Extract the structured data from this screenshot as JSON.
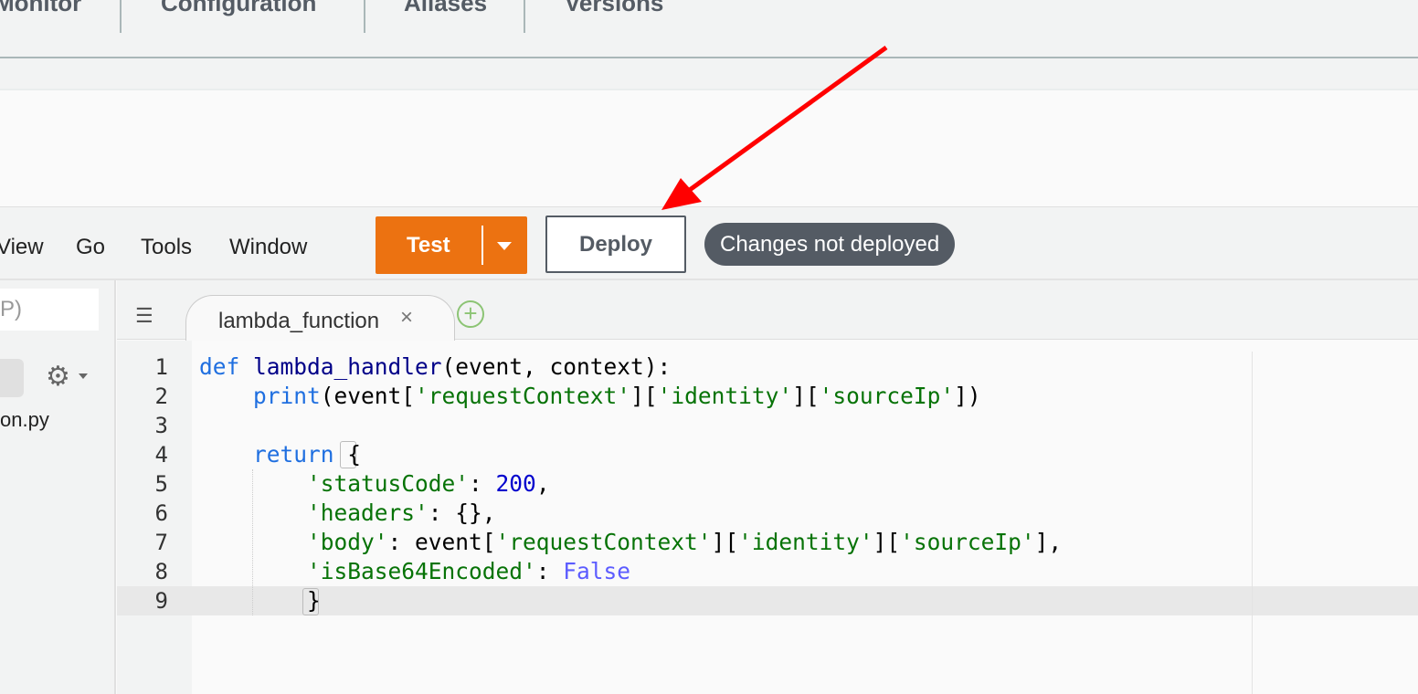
{
  "function_tabs": [
    "Monitor",
    "Configuration",
    "Aliases",
    "Versions"
  ],
  "menu": [
    "View",
    "Go",
    "Tools",
    "Window"
  ],
  "toolbar": {
    "test_label": "Test",
    "deploy_label": "Deploy",
    "status_badge": "Changes not deployed"
  },
  "sidebar": {
    "search_placeholder_fragment": "P)",
    "file_name": "on.py"
  },
  "editor": {
    "tab_label": "lambda_function",
    "close": "×",
    "add": "+",
    "line_numbers": [
      "1",
      "2",
      "3",
      "4",
      "5",
      "6",
      "7",
      "8",
      "9"
    ],
    "lines": [
      [
        [
          "k",
          "def"
        ],
        [
          "p",
          " "
        ],
        [
          "f",
          "lambda_handler"
        ],
        [
          "p",
          "(event, context):"
        ]
      ],
      [
        [
          "p",
          "    "
        ],
        [
          "k",
          "print"
        ],
        [
          "p",
          "(event["
        ],
        [
          "s",
          "'requestContext'"
        ],
        [
          "p",
          "]["
        ],
        [
          "s",
          "'identity'"
        ],
        [
          "p",
          "]["
        ],
        [
          "s",
          "'sourceIp'"
        ],
        [
          "p",
          "])"
        ]
      ],
      [],
      [
        [
          "p",
          "    "
        ],
        [
          "k",
          "return"
        ],
        [
          "p",
          " {"
        ]
      ],
      [
        [
          "p",
          "        "
        ],
        [
          "s",
          "'statusCode'"
        ],
        [
          "p",
          ": "
        ],
        [
          "n",
          "200"
        ],
        [
          "p",
          ","
        ]
      ],
      [
        [
          "p",
          "        "
        ],
        [
          "s",
          "'headers'"
        ],
        [
          "p",
          ": {},"
        ]
      ],
      [
        [
          "p",
          "        "
        ],
        [
          "s",
          "'body'"
        ],
        [
          "p",
          ": event["
        ],
        [
          "s",
          "'requestContext'"
        ],
        [
          "p",
          "]["
        ],
        [
          "s",
          "'identity'"
        ],
        [
          "p",
          "]["
        ],
        [
          "s",
          "'sourceIp'"
        ],
        [
          "p",
          "],"
        ]
      ],
      [
        [
          "p",
          "        "
        ],
        [
          "s",
          "'isBase64Encoded'"
        ],
        [
          "p",
          ": "
        ],
        [
          "c",
          "False"
        ]
      ],
      [
        [
          "p",
          "        }"
        ]
      ]
    ]
  },
  "colors": {
    "accent": "#ec7211",
    "arrow": "#ff0000",
    "badge": "#545b64"
  }
}
